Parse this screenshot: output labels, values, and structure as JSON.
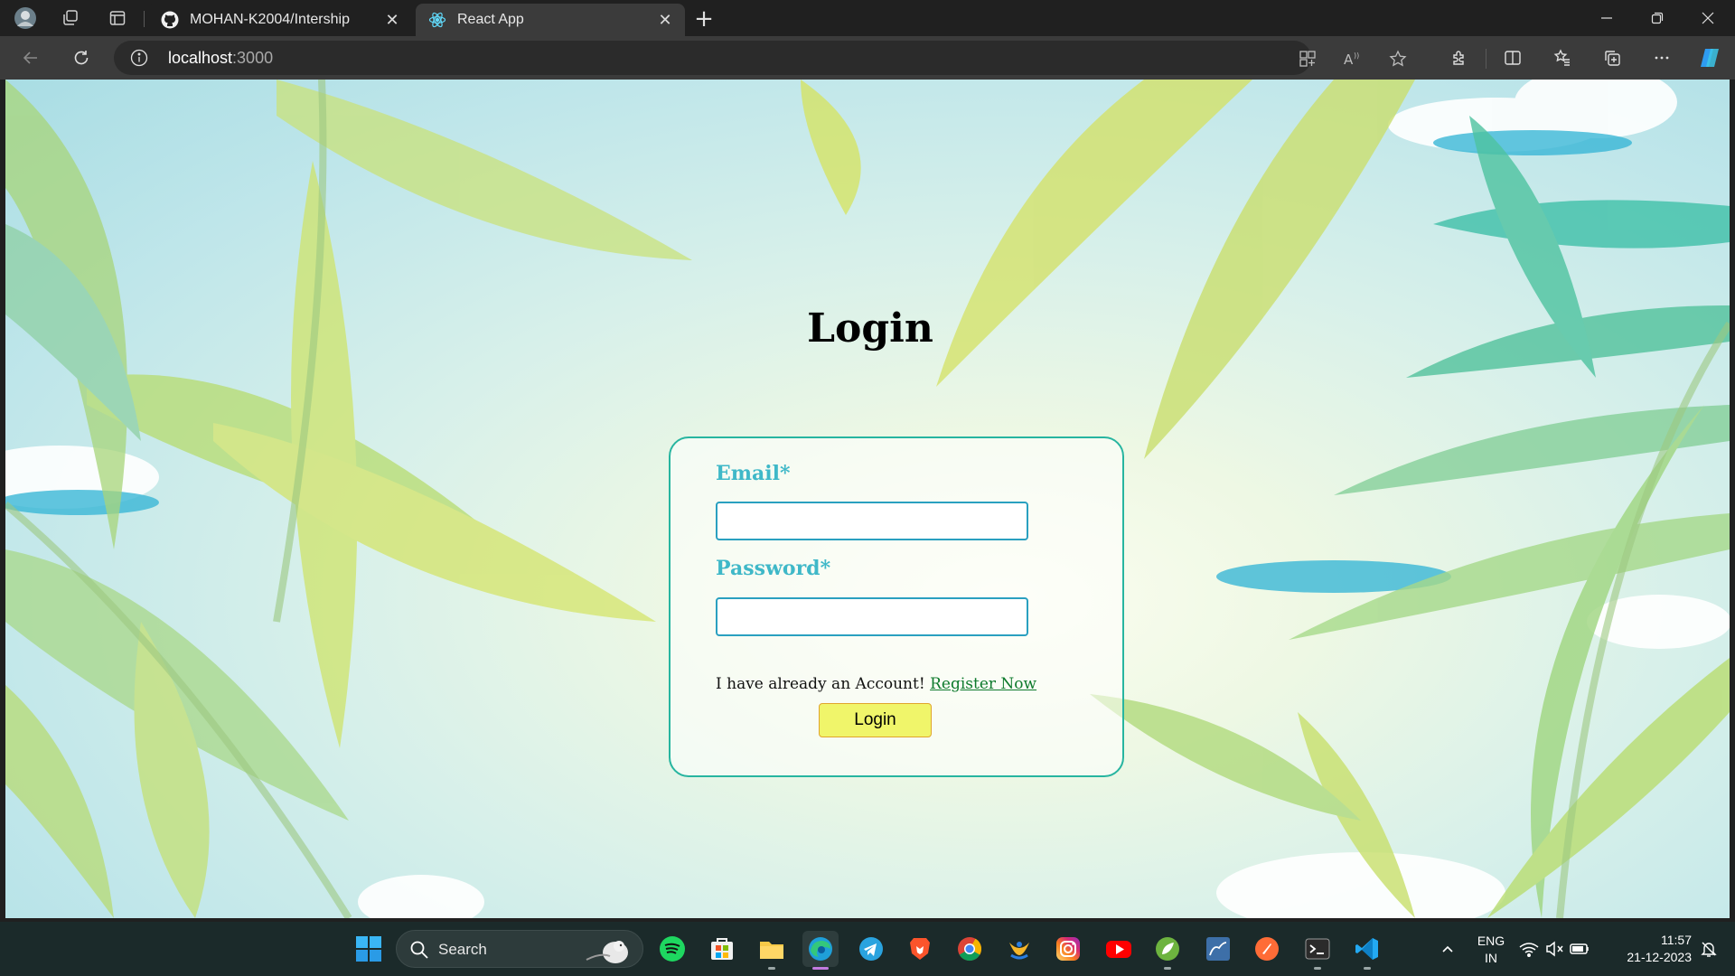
{
  "browser": {
    "tabs": [
      {
        "title": "MOHAN-K2004/Intership",
        "favicon": "github-icon",
        "active": false
      },
      {
        "title": "React App",
        "favicon": "react-icon",
        "active": true
      }
    ],
    "address": {
      "host": "localhost",
      "port": ":3000"
    }
  },
  "page": {
    "title": "Login",
    "form": {
      "email_label": "Email*",
      "email_value": "",
      "password_label": "Password*",
      "password_value": "",
      "register_prompt": "I have already an Account!",
      "register_link": "Register Now",
      "submit_label": "Login"
    },
    "colors": {
      "card_border": "#27b5a0",
      "label": "#3fb8c8",
      "button_bg": "#f0f56a",
      "link": "#0e7a2d"
    }
  },
  "taskbar": {
    "search_label": "Search",
    "apps": [
      "windows-start",
      "spotify",
      "microsoft-store",
      "file-explorer",
      "edge",
      "telegram",
      "brave",
      "chrome",
      "app",
      "instagram",
      "youtube",
      "spring-tool",
      "database",
      "postman",
      "terminal",
      "vscode"
    ],
    "lang": {
      "line1": "ENG",
      "line2": "IN"
    },
    "time": "11:57",
    "date": "21-12-2023"
  }
}
